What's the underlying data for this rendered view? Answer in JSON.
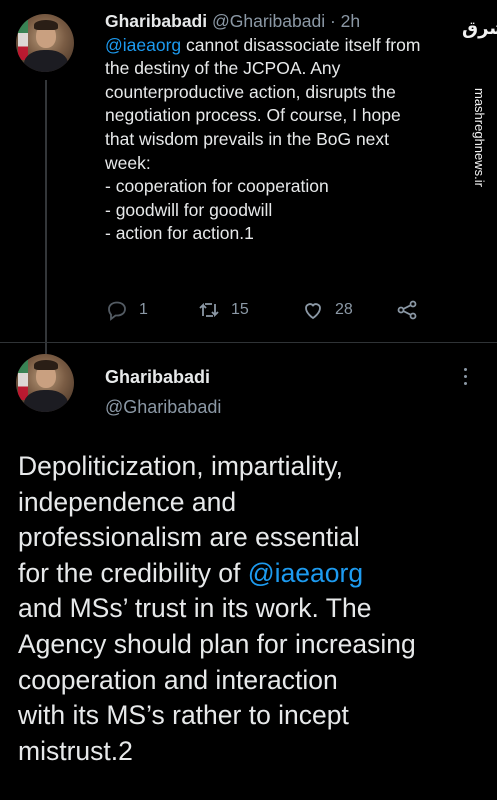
{
  "tweet1": {
    "author_name": "Gharibabadi",
    "handle": "@Gharibabadi",
    "separator": "·",
    "time": "2h",
    "lines": [
      {
        "mention": "@iaeaorg",
        "text": " cannot disassociate itself from"
      },
      {
        "mention": "",
        "text": "the destiny of the JCPOA. Any"
      },
      {
        "mention": "",
        "text": "counterproductive action, disrupts the"
      },
      {
        "mention": "",
        "text": "negotiation process. Of course, I hope"
      },
      {
        "mention": "",
        "text": "that wisdom prevails in the BoG next"
      },
      {
        "mention": "",
        "text": "week:"
      },
      {
        "mention": "",
        "text": "- cooperation for cooperation"
      },
      {
        "mention": "",
        "text": "- goodwill for goodwill"
      },
      {
        "mention": "",
        "text": "- action for action.1"
      }
    ],
    "actions": {
      "reply_count": "1",
      "retweet_count": "15",
      "like_count": "28"
    }
  },
  "tweet2": {
    "author_name": "Gharibabadi",
    "handle": "@Gharibabadi",
    "lines": [
      {
        "pre": "Depoliticization, impartiality,",
        "mention": "",
        "post": ""
      },
      {
        "pre": "independence and",
        "mention": "",
        "post": ""
      },
      {
        "pre": "professionalism are essential",
        "mention": "",
        "post": ""
      },
      {
        "pre": "for the credibility of ",
        "mention": "@iaeaorg",
        "post": ""
      },
      {
        "pre": "and MSs’ trust in its work. The",
        "mention": "",
        "post": ""
      },
      {
        "pre": "Agency should plan for increasing",
        "mention": "",
        "post": ""
      },
      {
        "pre": "cooperation and interaction",
        "mention": "",
        "post": ""
      },
      {
        "pre": "with its MS’s rather to incept",
        "mention": "",
        "post": ""
      },
      {
        "pre": "mistrust.2",
        "mention": "",
        "post": ""
      }
    ]
  },
  "watermark": {
    "logo_text": "مشرق",
    "url": "mashreghnews.ir"
  },
  "colors": {
    "background": "#000000",
    "text": "#e7e9ea",
    "secondary": "#8b98a5",
    "link": "#1d9bf0",
    "divider": "#2f3336"
  },
  "icons": [
    "reply-icon",
    "retweet-icon",
    "like-icon",
    "share-icon",
    "more-icon"
  ]
}
